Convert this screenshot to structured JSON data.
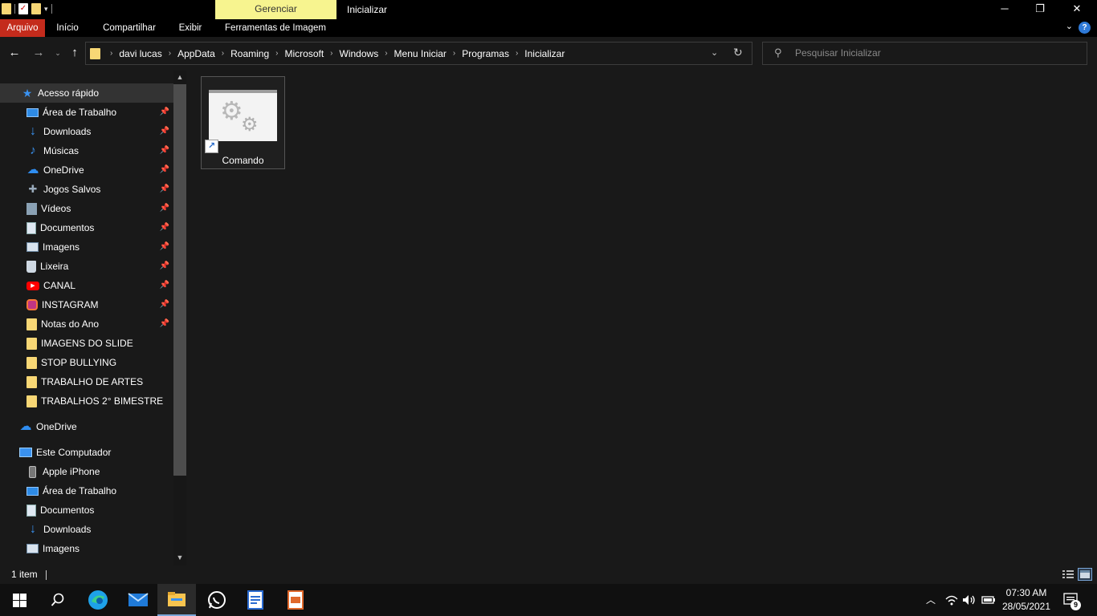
{
  "window": {
    "title": "Inicializar",
    "context_tab": "Gerenciar",
    "controls": {
      "minimize": "─",
      "restore": "❐",
      "close": "✕"
    }
  },
  "ribbon": {
    "tabs": [
      {
        "label": "Arquivo",
        "active": true
      },
      {
        "label": "Início"
      },
      {
        "label": "Compartilhar"
      },
      {
        "label": "Exibir"
      },
      {
        "label": "Ferramentas de Imagem"
      }
    ],
    "help": "?"
  },
  "address": {
    "crumbs": [
      "davi lucas",
      "AppData",
      "Roaming",
      "Microsoft",
      "Windows",
      "Menu Iniciar",
      "Programas",
      "Inicializar"
    ]
  },
  "search": {
    "placeholder": "Pesquisar Inicializar"
  },
  "sidebar": {
    "quick_access": "Acesso rápido",
    "pinned": [
      {
        "label": "Área de Trabalho",
        "icon": "desktop-icon"
      },
      {
        "label": "Downloads",
        "icon": "download-icon"
      },
      {
        "label": "Músicas",
        "icon": "music-icon"
      },
      {
        "label": "OneDrive",
        "icon": "cloud-icon"
      },
      {
        "label": "Jogos Salvos",
        "icon": "game-icon"
      },
      {
        "label": "Vídeos",
        "icon": "video-icon"
      },
      {
        "label": "Documentos",
        "icon": "document-icon"
      },
      {
        "label": "Imagens",
        "icon": "image-icon"
      },
      {
        "label": "Lixeira",
        "icon": "trash-icon"
      },
      {
        "label": "CANAL",
        "icon": "youtube-icon"
      },
      {
        "label": "INSTAGRAM",
        "icon": "instagram-icon"
      },
      {
        "label": "Notas do Ano",
        "icon": "folder-icon"
      }
    ],
    "recent": [
      {
        "label": "IMAGENS DO SLIDE"
      },
      {
        "label": "STOP BULLYING"
      },
      {
        "label": "TRABALHO DE ARTES"
      },
      {
        "label": "TRABALHOS 2° BIMESTRE"
      }
    ],
    "onedrive": "OneDrive",
    "computer": "Este Computador",
    "computer_items": [
      {
        "label": "Apple iPhone",
        "icon": "phone-icon"
      },
      {
        "label": "Área de Trabalho",
        "icon": "desktop-icon"
      },
      {
        "label": "Documentos",
        "icon": "document-icon"
      },
      {
        "label": "Downloads",
        "icon": "download-icon"
      },
      {
        "label": "Imagens",
        "icon": "image-icon"
      }
    ]
  },
  "files": [
    {
      "name": "Comando",
      "type": "shortcut"
    }
  ],
  "status": {
    "count": "1 item"
  },
  "taskbar": {
    "time": "07:30 AM",
    "date": "28/05/2021",
    "notifications": "9"
  }
}
